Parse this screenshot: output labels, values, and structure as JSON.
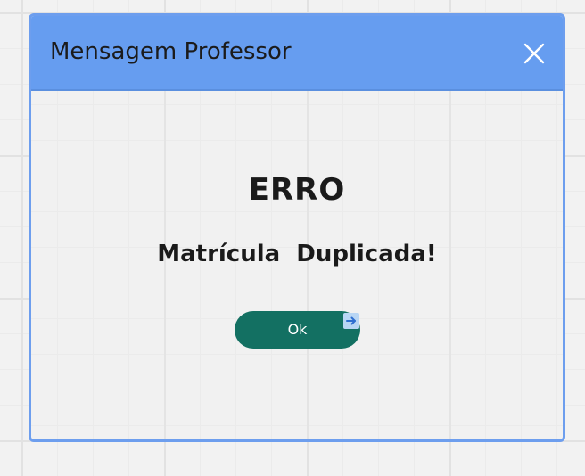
{
  "dialog": {
    "title": "Mensagem Professor",
    "close_icon": "close-icon",
    "heading": "ERRO",
    "message": "Matrícula  Duplicada!",
    "ok_label": "Ok",
    "link_icon": "arrow-right-icon"
  },
  "colors": {
    "header": "#669df0",
    "border": "#6d9eee",
    "button": "#137062",
    "text": "#1a1a1a"
  }
}
